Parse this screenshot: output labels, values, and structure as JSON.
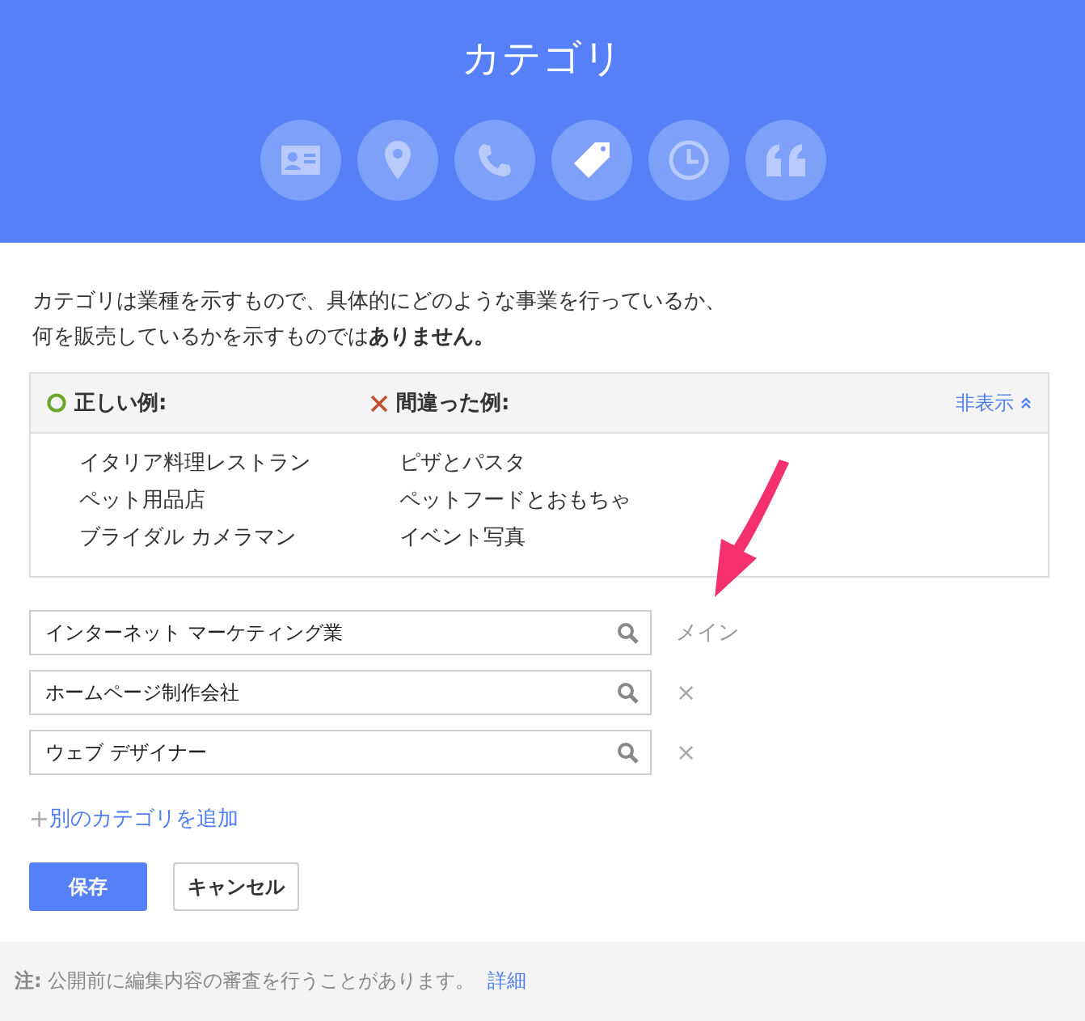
{
  "header": {
    "title": "カテゴリ",
    "steps": [
      {
        "kind": "card",
        "selected": false
      },
      {
        "kind": "pin",
        "selected": false
      },
      {
        "kind": "phone",
        "selected": false
      },
      {
        "kind": "tag",
        "selected": true
      },
      {
        "kind": "clock",
        "selected": false
      },
      {
        "kind": "quote",
        "selected": false
      }
    ]
  },
  "description": "カテゴリは業種を示すもので、具体的にどのような事業を行っているか、何を販売しているかを示すものでは**ありません。**",
  "examples": {
    "good_heading": "正しい例:",
    "bad_heading": "間違った例:",
    "toggle": "非表示",
    "good": [
      "イタリア料理レストラン",
      "ペット用品店",
      "ブライダル カメラマン"
    ],
    "bad": [
      "ピザとパスタ",
      "ペットフードとおもちゃ",
      "イベント写真"
    ]
  },
  "categories": [
    {
      "value": "インターネット マーケティング業",
      "kind": "primary",
      "label": "メイン"
    },
    {
      "value": "ホームページ制作会社",
      "kind": "extra",
      "label": "×"
    },
    {
      "value": "ウェブ デザイナー",
      "kind": "extra",
      "label": "×"
    }
  ],
  "add_link": {
    "icon": "+",
    "label": "別のカテゴリを追加"
  },
  "buttons": {
    "save": "保存",
    "cancel": "キャンセル"
  },
  "footer": {
    "note": "**注:** 公開前に編集内容の審査を行うことがあります。",
    "link": "詳細"
  }
}
